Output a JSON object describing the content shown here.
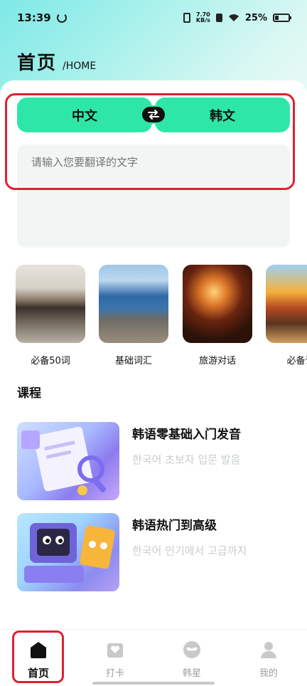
{
  "status_bar": {
    "time": "13:39",
    "net_speed_top": "7.70",
    "net_speed_unit": "KB/s",
    "battery_pct": "25%",
    "battery_level": 0.25
  },
  "header": {
    "title": "首页",
    "subtitle": "/HOME"
  },
  "translator": {
    "source_lang": "中文",
    "target_lang": "韩文",
    "input_placeholder": "请输入您要翻译的文字",
    "input_value": ""
  },
  "scenes": [
    {
      "label": "必备50词"
    },
    {
      "label": "基础词汇"
    },
    {
      "label": "旅游对话"
    },
    {
      "label": "必备词"
    }
  ],
  "courses_section": {
    "title": "课程",
    "items": [
      {
        "title": "韩语零基础入门发音",
        "subtitle": "한국어 초보자 입문 발음"
      },
      {
        "title": "韩语热门到高级",
        "subtitle": "한국어 인기에서 고급까지"
      }
    ]
  },
  "tabbar": {
    "items": [
      {
        "label": "首页",
        "icon": "home-icon",
        "active": true
      },
      {
        "label": "打卡",
        "icon": "checkin-icon",
        "active": false
      },
      {
        "label": "韩星",
        "icon": "star-mask-icon",
        "active": false
      },
      {
        "label": "我的",
        "icon": "profile-icon",
        "active": false
      }
    ]
  },
  "colors": {
    "accent_green": "#2ee6a8",
    "highlight_red": "#e02030"
  }
}
